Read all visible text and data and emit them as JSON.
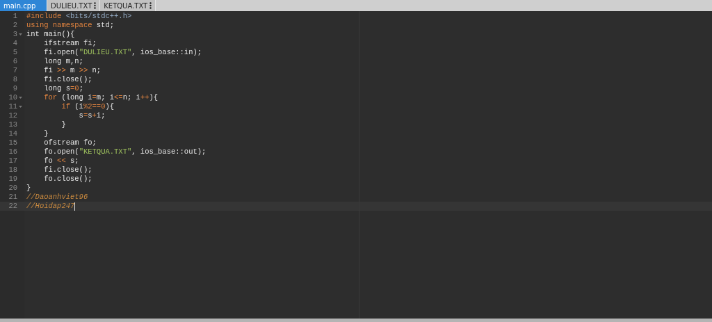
{
  "tabs": [
    {
      "label": "main.cpp",
      "selected": true,
      "menu": false
    },
    {
      "label": "DULIEU.TXT",
      "selected": false,
      "menu": true
    },
    {
      "label": "KETQUA.TXT",
      "selected": false,
      "menu": true
    }
  ],
  "editor": {
    "lines": [
      {
        "number": "1",
        "foldable": false,
        "active": false,
        "tokens": [
          {
            "t": "#include ",
            "kind": "keyword"
          },
          {
            "t": "<bits/stdc++.h>",
            "kind": "header"
          }
        ]
      },
      {
        "number": "2",
        "foldable": false,
        "active": false,
        "tokens": [
          {
            "t": "using namespace",
            "kind": "keyword"
          },
          {
            "t": " std;",
            "kind": "plain"
          }
        ]
      },
      {
        "number": "3",
        "foldable": true,
        "active": false,
        "tokens": [
          {
            "t": "int main(){",
            "kind": "plain"
          }
        ]
      },
      {
        "number": "4",
        "foldable": false,
        "active": false,
        "tokens": [
          {
            "t": "    ifstream fi;",
            "kind": "plain"
          }
        ]
      },
      {
        "number": "5",
        "foldable": false,
        "active": false,
        "tokens": [
          {
            "t": "    fi.open(",
            "kind": "plain"
          },
          {
            "t": "\"DULIEU.TXT\"",
            "kind": "string"
          },
          {
            "t": ", ios_base::in);",
            "kind": "plain"
          }
        ]
      },
      {
        "number": "6",
        "foldable": false,
        "active": false,
        "tokens": [
          {
            "t": "    long m,n;",
            "kind": "plain"
          }
        ]
      },
      {
        "number": "7",
        "foldable": false,
        "active": false,
        "tokens": [
          {
            "t": "    fi ",
            "kind": "plain"
          },
          {
            "t": ">>",
            "kind": "operator"
          },
          {
            "t": " m ",
            "kind": "plain"
          },
          {
            "t": ">>",
            "kind": "operator"
          },
          {
            "t": " n;",
            "kind": "plain"
          }
        ]
      },
      {
        "number": "8",
        "foldable": false,
        "active": false,
        "tokens": [
          {
            "t": "    fi.close();",
            "kind": "plain"
          }
        ]
      },
      {
        "number": "9",
        "foldable": false,
        "active": false,
        "tokens": [
          {
            "t": "    long s",
            "kind": "plain"
          },
          {
            "t": "=",
            "kind": "operator"
          },
          {
            "t": "0",
            "kind": "number"
          },
          {
            "t": ";",
            "kind": "plain"
          }
        ]
      },
      {
        "number": "10",
        "foldable": true,
        "active": false,
        "tokens": [
          {
            "t": "    for",
            "kind": "keyword"
          },
          {
            "t": " (long i",
            "kind": "plain"
          },
          {
            "t": "=",
            "kind": "operator"
          },
          {
            "t": "m; i",
            "kind": "plain"
          },
          {
            "t": "<=",
            "kind": "operator"
          },
          {
            "t": "n; i",
            "kind": "plain"
          },
          {
            "t": "++",
            "kind": "operator"
          },
          {
            "t": "){",
            "kind": "plain"
          }
        ]
      },
      {
        "number": "11",
        "foldable": true,
        "active": false,
        "tokens": [
          {
            "t": "        if",
            "kind": "keyword"
          },
          {
            "t": " (i",
            "kind": "plain"
          },
          {
            "t": "%",
            "kind": "operator"
          },
          {
            "t": "2",
            "kind": "number"
          },
          {
            "t": "==",
            "kind": "operator"
          },
          {
            "t": "0",
            "kind": "number"
          },
          {
            "t": "){",
            "kind": "plain"
          }
        ]
      },
      {
        "number": "12",
        "foldable": false,
        "active": false,
        "tokens": [
          {
            "t": "            s",
            "kind": "plain"
          },
          {
            "t": "=",
            "kind": "operator"
          },
          {
            "t": "s",
            "kind": "plain"
          },
          {
            "t": "+",
            "kind": "operator"
          },
          {
            "t": "i;",
            "kind": "plain"
          }
        ]
      },
      {
        "number": "13",
        "foldable": false,
        "active": false,
        "tokens": [
          {
            "t": "        }",
            "kind": "plain"
          }
        ]
      },
      {
        "number": "14",
        "foldable": false,
        "active": false,
        "tokens": [
          {
            "t": "    }",
            "kind": "plain"
          }
        ]
      },
      {
        "number": "15",
        "foldable": false,
        "active": false,
        "tokens": [
          {
            "t": "    ofstream fo;",
            "kind": "plain"
          }
        ]
      },
      {
        "number": "16",
        "foldable": false,
        "active": false,
        "tokens": [
          {
            "t": "    fo.open(",
            "kind": "plain"
          },
          {
            "t": "\"KETQUA.TXT\"",
            "kind": "string"
          },
          {
            "t": ", ios_base::out);",
            "kind": "plain"
          }
        ]
      },
      {
        "number": "17",
        "foldable": false,
        "active": false,
        "tokens": [
          {
            "t": "    fo ",
            "kind": "plain"
          },
          {
            "t": "<<",
            "kind": "operator"
          },
          {
            "t": " s;",
            "kind": "plain"
          }
        ]
      },
      {
        "number": "18",
        "foldable": false,
        "active": false,
        "tokens": [
          {
            "t": "    fi.close();",
            "kind": "plain"
          }
        ]
      },
      {
        "number": "19",
        "foldable": false,
        "active": false,
        "tokens": [
          {
            "t": "    fo.close();",
            "kind": "plain"
          }
        ]
      },
      {
        "number": "20",
        "foldable": false,
        "active": false,
        "tokens": [
          {
            "t": "}",
            "kind": "plain"
          }
        ]
      },
      {
        "number": "21",
        "foldable": false,
        "active": false,
        "tokens": [
          {
            "t": "//Daoanhviet96",
            "kind": "comment"
          }
        ]
      },
      {
        "number": "22",
        "foldable": false,
        "active": true,
        "tokens": [
          {
            "t": "//Hoidap247",
            "kind": "comment"
          }
        ]
      }
    ]
  }
}
